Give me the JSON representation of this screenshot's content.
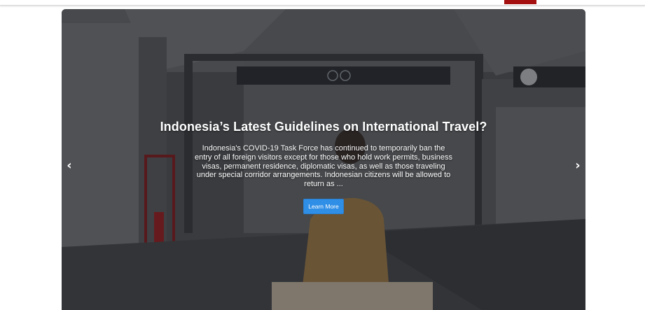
{
  "header": {
    "accent_color": "#a3100f"
  },
  "slide": {
    "title": "Indonesia’s Latest Guidelines on International Travel?",
    "description": "Indonesia's COVID-19 Task Force has continued to temporarily ban the entry of all foreign visitors except for those who hold work permits, business visas, permanent residence, diplomatic visas, as well as those traveling under special corridor arrangements. Indonesian citizens will be allowed to return as ...",
    "button_label": "Learn More",
    "button_color": "#2f8ee6"
  },
  "controls": {
    "prev_icon": "‹",
    "next_icon": "›"
  }
}
